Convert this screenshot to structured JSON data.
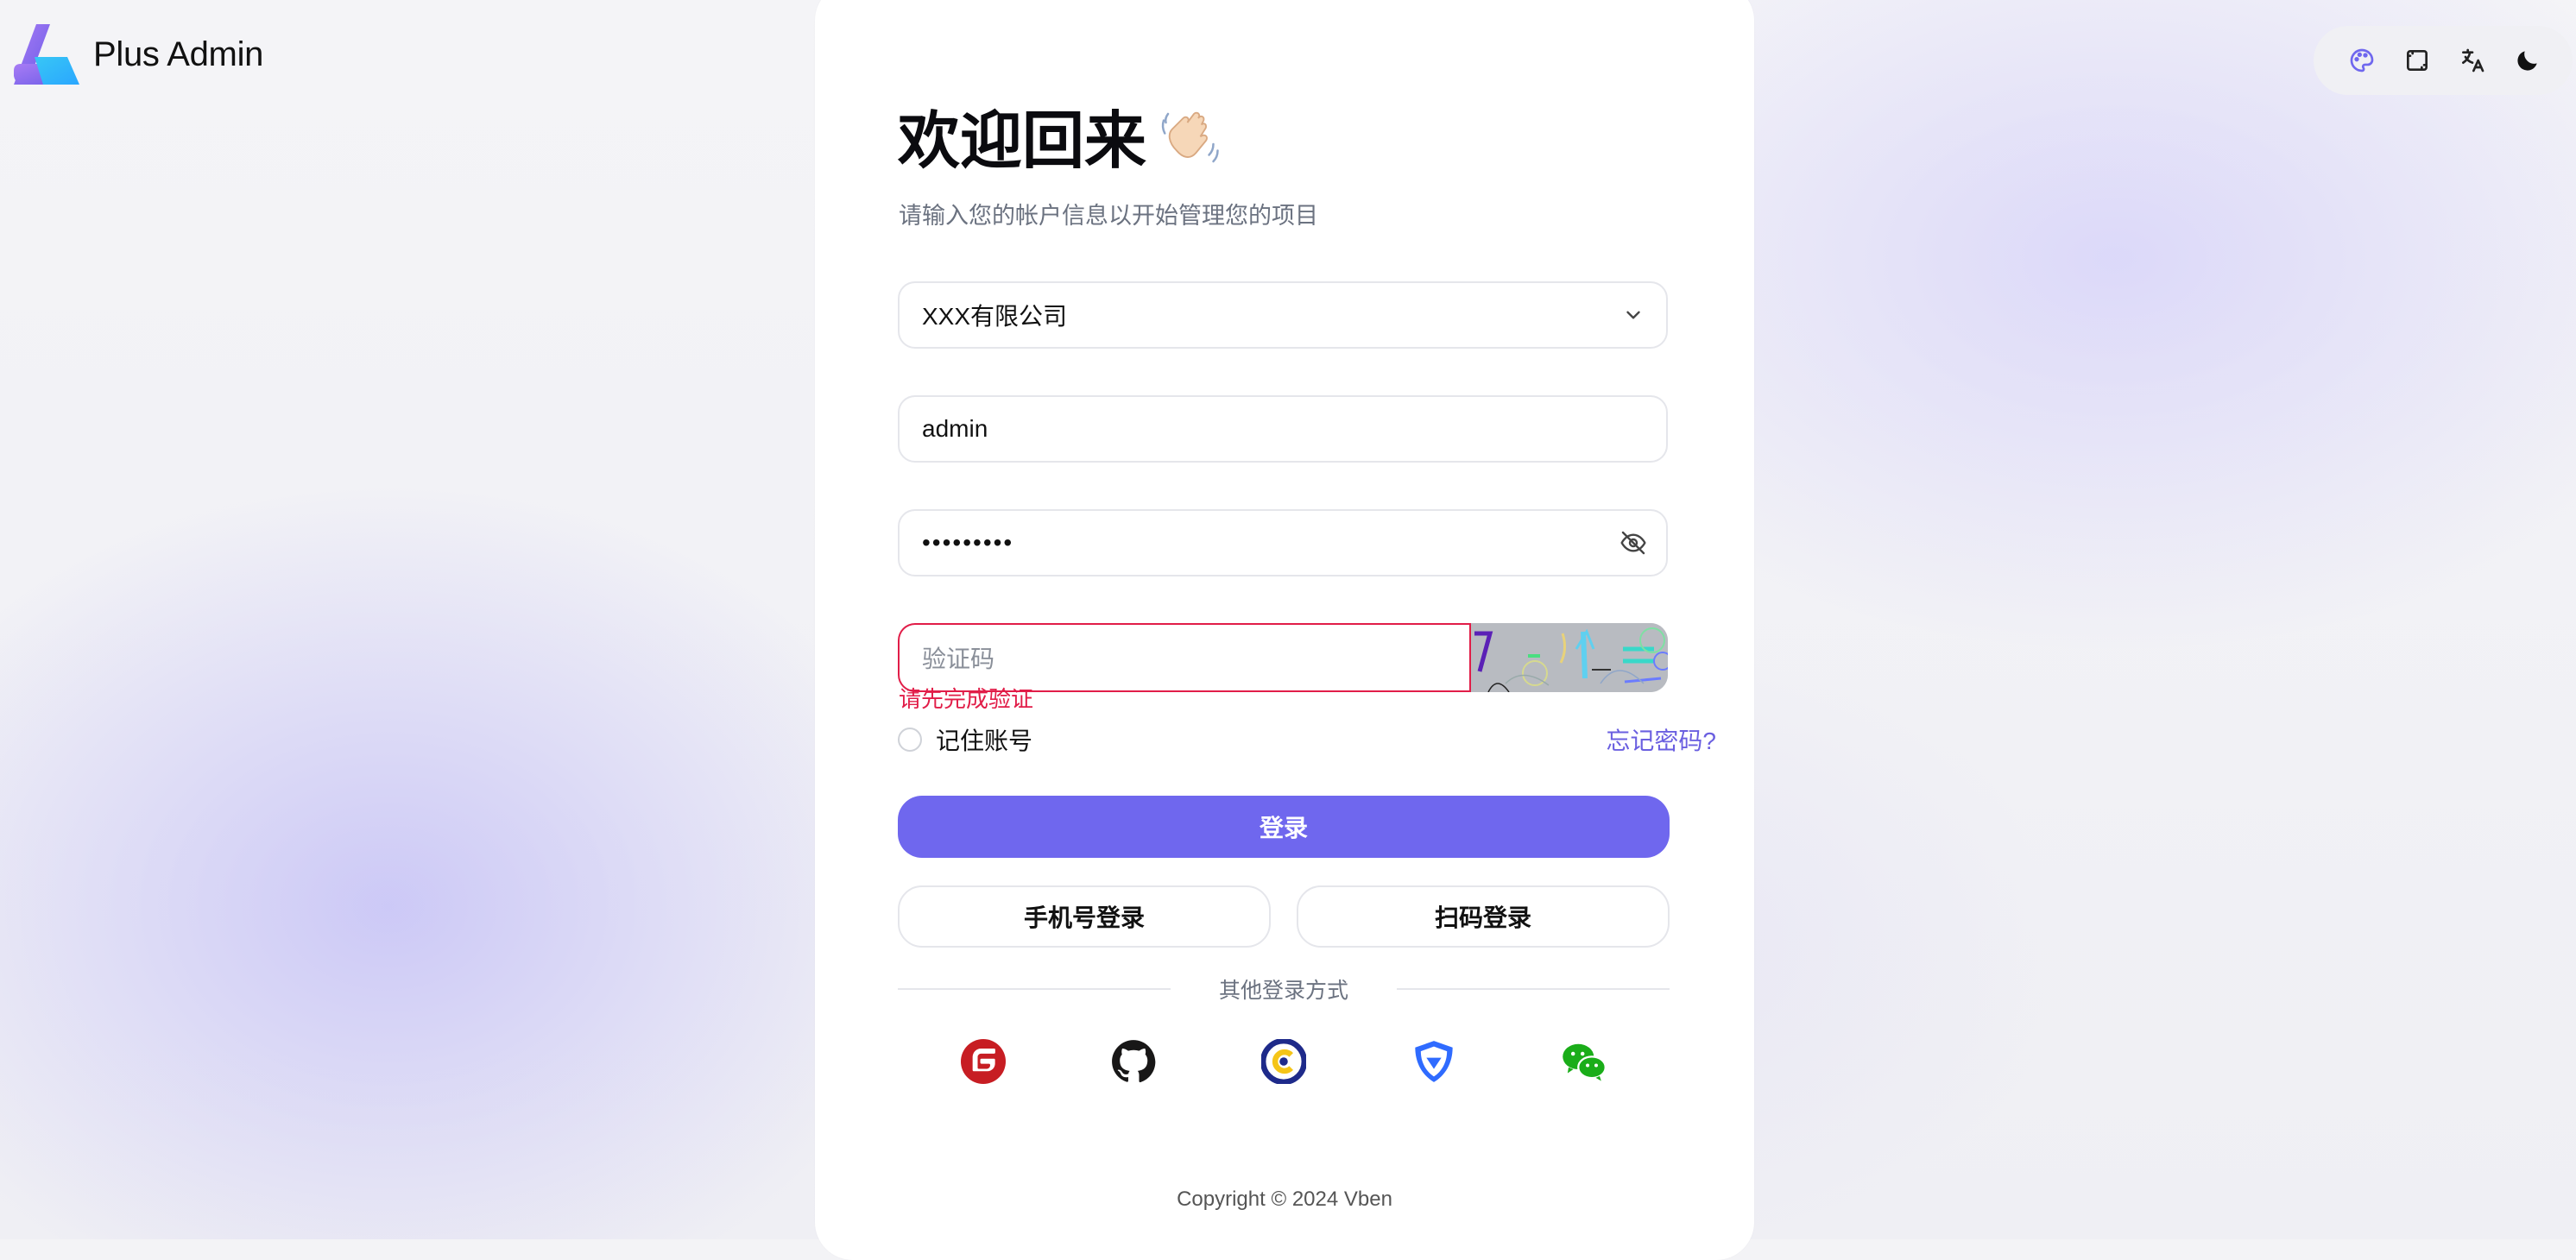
{
  "app": {
    "name": "Plus Admin"
  },
  "toolbar": {
    "items": [
      {
        "icon": "palette-icon"
      },
      {
        "icon": "layout-icon"
      },
      {
        "icon": "translate-icon"
      },
      {
        "icon": "moon-icon"
      }
    ]
  },
  "login": {
    "title": "欢迎回来",
    "title_emoji": "waving-hand-icon",
    "subtitle": "请输入您的帐户信息以开始管理您的项目",
    "tenant": {
      "value": "XXX有限公司"
    },
    "username": {
      "value": "admin"
    },
    "password": {
      "value": "•••••••••"
    },
    "captcha": {
      "placeholder": "验证码",
      "error": "请先完成验证"
    },
    "remember_label": "记住账号",
    "forgot_label": "忘记密码?",
    "submit_label": "登录",
    "phone_login_label": "手机号登录",
    "qr_login_label": "扫码登录",
    "other_methods_label": "其他登录方式",
    "social": [
      {
        "icon": "gitee-icon",
        "color": "#c71d23"
      },
      {
        "icon": "github-icon",
        "color": "#181717"
      },
      {
        "icon": "maxkey-icon",
        "color": "#1e2a8a"
      },
      {
        "icon": "topiam-icon",
        "color": "#2f6bff"
      },
      {
        "icon": "wechat-icon",
        "color": "#1aad19"
      }
    ]
  },
  "footer": {
    "copyright": "Copyright © 2024 Vben"
  },
  "colors": {
    "primary": "#6f67ee",
    "error": "#e11d48"
  }
}
